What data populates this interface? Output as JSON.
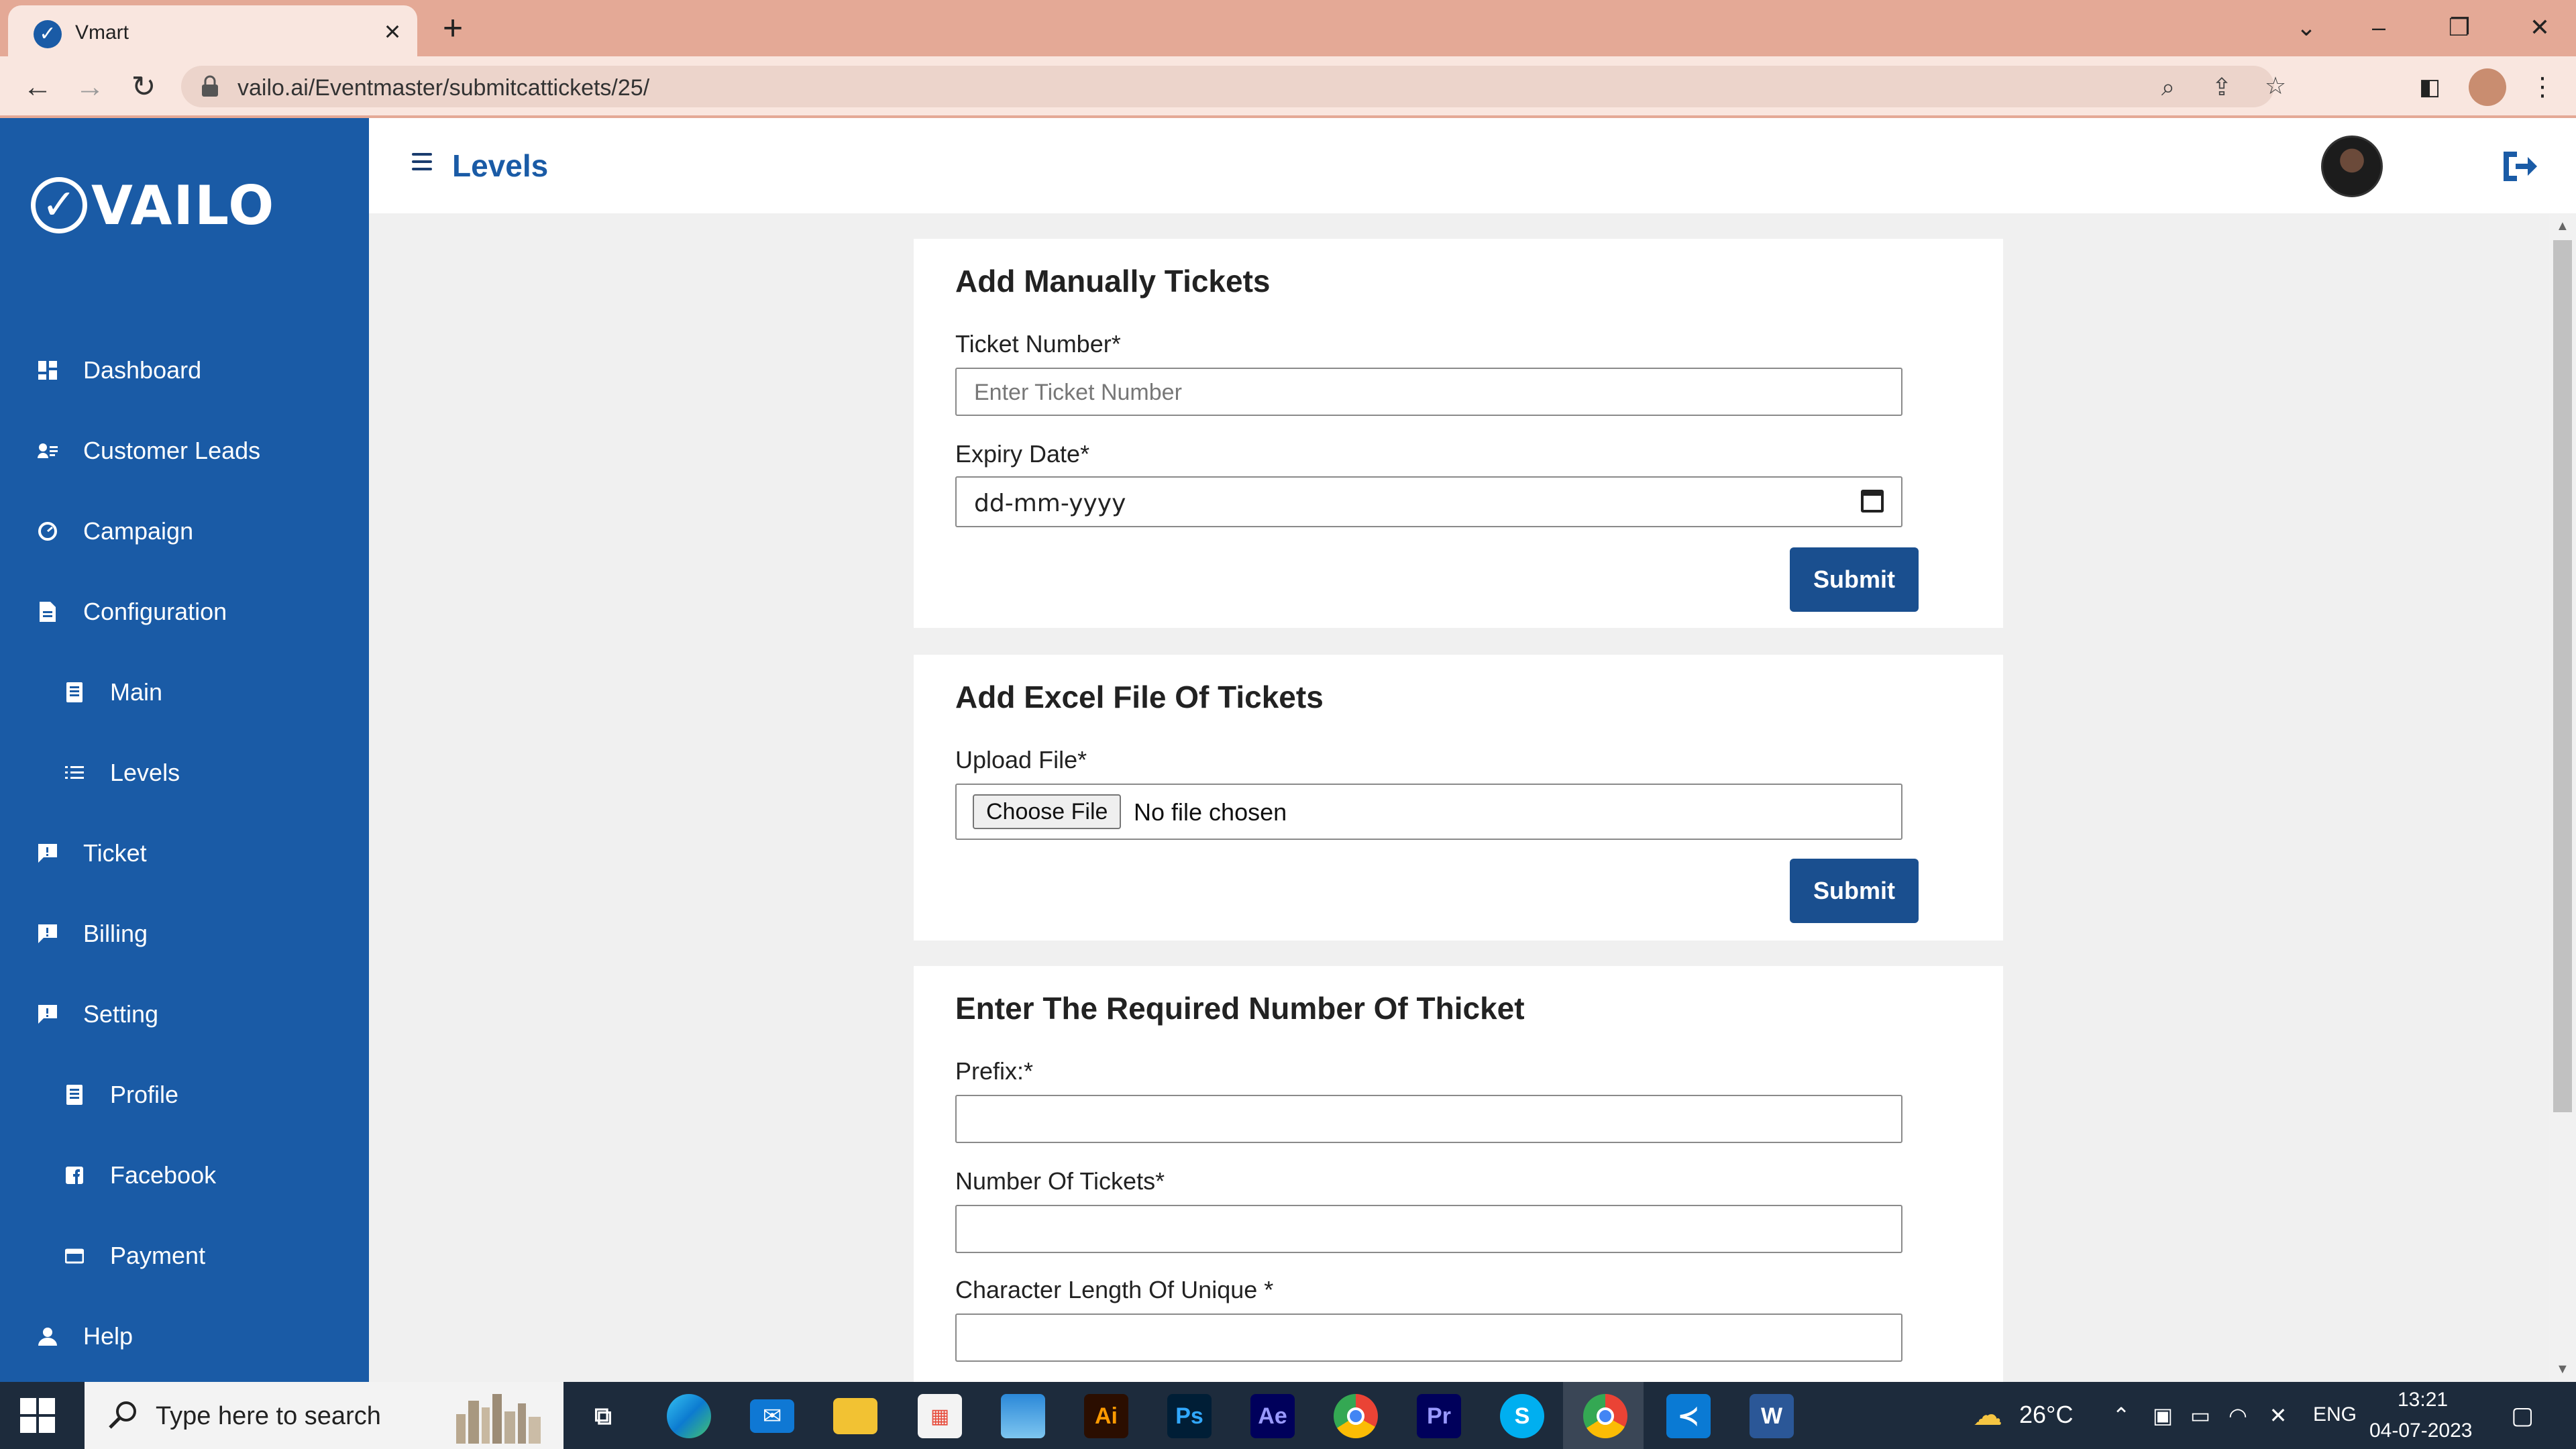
{
  "browser": {
    "tab_title": "Vmart",
    "url": "vailo.ai/Eventmaster/submitcattickets/25/"
  },
  "sidebar": {
    "logo_text": "VAILO",
    "items": [
      {
        "label": "Dashboard",
        "icon": "dashboard-icon"
      },
      {
        "label": "Customer Leads",
        "icon": "contacts-icon"
      },
      {
        "label": "Campaign",
        "icon": "gauge-icon"
      },
      {
        "label": "Configuration",
        "icon": "document-icon"
      },
      {
        "label": "Main",
        "icon": "page-icon"
      },
      {
        "label": "Levels",
        "icon": "list-icon"
      },
      {
        "label": "Ticket",
        "icon": "chat-icon"
      },
      {
        "label": "Billing",
        "icon": "chat-icon"
      },
      {
        "label": "Setting",
        "icon": "chat-icon"
      },
      {
        "label": "Profile",
        "icon": "page-icon"
      },
      {
        "label": "Facebook",
        "icon": "facebook-icon"
      },
      {
        "label": "Payment",
        "icon": "wallet-icon"
      },
      {
        "label": "Help",
        "icon": "person-icon"
      }
    ]
  },
  "header": {
    "title": "Levels"
  },
  "manual": {
    "title": "Add Manually Tickets",
    "ticket_label": "Ticket Number*",
    "ticket_placeholder": "Enter Ticket Number",
    "expiry_label": "Expiry Date*",
    "expiry_value": "dd-mm-yyyy",
    "submit_label": "Submit"
  },
  "excel": {
    "title": "Add Excel File Of Tickets",
    "upload_label": "Upload File*",
    "choose_label": "Choose File",
    "no_file": "No file chosen",
    "submit_label": "Submit"
  },
  "generate": {
    "title": "Enter The Required Number Of Thicket",
    "prefix_label": "Prefix:*",
    "count_label": "Number Of Tickets*",
    "length_label": "Character Length Of Unique *"
  },
  "taskbar": {
    "search_placeholder": "Type here to search",
    "weather": "26°C",
    "language": "ENG",
    "time": "13:21",
    "date": "04-07-2023",
    "apps": [
      "task-view",
      "edge",
      "mail",
      "file-explorer",
      "store",
      "photos",
      "illustrator",
      "photoshop",
      "after-effects",
      "chrome",
      "premiere",
      "skype",
      "chrome-active",
      "vscode",
      "word"
    ]
  },
  "colors": {
    "sidebar": "#1a5ba6",
    "accent_button": "#1a4f8f",
    "browser_frame": "#e4a996",
    "page_bg": "#f0f0f0"
  }
}
